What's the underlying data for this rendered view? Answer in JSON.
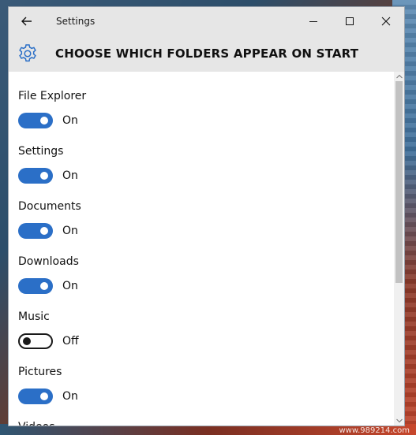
{
  "window": {
    "title": "Settings",
    "header_title": "CHOOSE WHICH FOLDERS APPEAR ON START"
  },
  "items": [
    {
      "label": "File Explorer",
      "state": "On",
      "on": true
    },
    {
      "label": "Settings",
      "state": "On",
      "on": true
    },
    {
      "label": "Documents",
      "state": "On",
      "on": true
    },
    {
      "label": "Downloads",
      "state": "On",
      "on": true
    },
    {
      "label": "Music",
      "state": "Off",
      "on": false
    },
    {
      "label": "Pictures",
      "state": "On",
      "on": true
    },
    {
      "label": "Videos",
      "state": "",
      "on": true
    }
  ],
  "watermark": "www.989214.com",
  "colors": {
    "accent": "#2b6fc7",
    "titlebar": "#e6e6e6"
  },
  "icons": {
    "back": "back-arrow-icon",
    "gear": "gear-icon",
    "minimize": "minimize-icon",
    "maximize": "maximize-icon",
    "close": "close-icon"
  }
}
